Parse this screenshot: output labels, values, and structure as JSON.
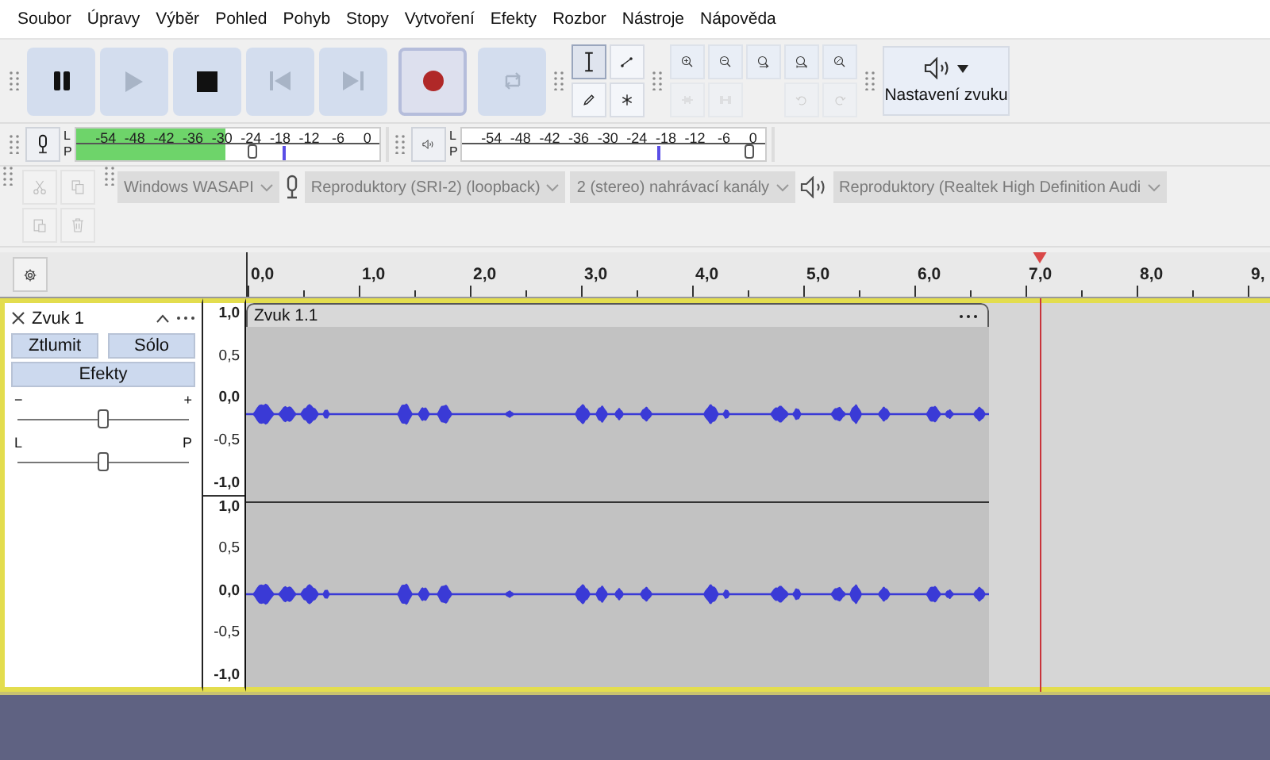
{
  "menu": [
    "Soubor",
    "Úpravy",
    "Výběr",
    "Pohled",
    "Pohyb",
    "Stopy",
    "Vytvoření",
    "Efekty",
    "Rozbor",
    "Nástroje",
    "Nápověda"
  ],
  "transport": [
    {
      "kind": "pause",
      "disabled": false,
      "pressed": false
    },
    {
      "kind": "play",
      "disabled": true,
      "pressed": false
    },
    {
      "kind": "stop",
      "disabled": false,
      "pressed": false
    },
    {
      "kind": "skip-start",
      "disabled": true,
      "pressed": false
    },
    {
      "kind": "skip-end",
      "disabled": true,
      "pressed": false
    },
    {
      "kind": "record",
      "disabled": false,
      "pressed": true
    },
    {
      "kind": "loop",
      "disabled": true,
      "pressed": false
    }
  ],
  "tools": [
    {
      "kind": "select",
      "selected": true
    },
    {
      "kind": "envelope",
      "selected": false
    },
    {
      "kind": "draw",
      "selected": false
    },
    {
      "kind": "multi",
      "selected": false
    }
  ],
  "edit_tools": [
    {
      "kind": "zoom-in",
      "disabled": false
    },
    {
      "kind": "zoom-out",
      "disabled": false
    },
    {
      "kind": "fit-selection",
      "disabled": false
    },
    {
      "kind": "fit-project",
      "disabled": false
    },
    {
      "kind": "zoom-toggle",
      "disabled": false
    },
    {
      "kind": "trim",
      "disabled": true
    },
    {
      "kind": "silence",
      "disabled": true
    },
    {
      "kind": "spacer"
    },
    {
      "kind": "undo",
      "disabled": true
    },
    {
      "kind": "redo",
      "disabled": true
    }
  ],
  "audio_setup": {
    "label": "Nastavení zvuku"
  },
  "meters": [
    {
      "kind": "record",
      "channels": [
        "L",
        "P"
      ],
      "ticks": [
        "-54",
        "-48",
        "-42",
        "-36",
        "-30",
        "-24",
        "-18",
        "-12",
        "-6",
        "0"
      ],
      "fill": {
        "level": 0.49
      },
      "peak": {
        "level": 0.68
      },
      "slider": {
        "level": 0.58
      }
    },
    {
      "kind": "playback",
      "channels": [
        "L",
        "P"
      ],
      "ticks": [
        "-54",
        "-48",
        "-42",
        "-36",
        "-30",
        "-24",
        "-18",
        "-12",
        "-6",
        "0"
      ],
      "peak": {
        "level": 0.645
      },
      "slider": {
        "level": 0.95
      }
    }
  ],
  "clipboard_tools": [
    {
      "kind": "cut",
      "disabled": true
    },
    {
      "kind": "copy",
      "disabled": true
    },
    {
      "kind": "paste",
      "disabled": true
    },
    {
      "kind": "delete",
      "disabled": true
    }
  ],
  "devices": [
    {
      "kind": "combo",
      "label": "Windows WASAPI",
      "disabled": true
    },
    {
      "kind": "mic",
      "disabled": true
    },
    {
      "kind": "combo",
      "label": "Reproduktory (SRI-2) (loopback)",
      "disabled": true
    },
    {
      "kind": "combo",
      "label": "2 (stereo) nahrávací kanály",
      "disabled": true
    },
    {
      "kind": "speaker",
      "disabled": true
    },
    {
      "kind": "combo",
      "label": "Reproduktory (Realtek High Definition Audi",
      "disabled": true
    }
  ],
  "ruler": {
    "labels": [
      "0,0",
      "1,0",
      "2,0",
      "3,0",
      "4,0",
      "5,0",
      "6,0",
      "7,0",
      "8,0",
      "9,"
    ],
    "playhead": {
      "level": 0.775
    }
  },
  "track": {
    "name": "Zvuk 1",
    "buttons": [
      {
        "label": "Ztlumit",
        "selected": false
      },
      {
        "label": "Sólo",
        "selected": false
      }
    ],
    "effects": {
      "label": "Efekty"
    },
    "gain": {
      "min_label": "−",
      "max_label": "+",
      "level": 0.5
    },
    "pan": {
      "min_label": "L",
      "max_label": "P",
      "level": 0.5
    },
    "clip": {
      "name": "Zvuk 1.1"
    },
    "channels": [
      {
        "scale": [
          "1,0",
          "0,5",
          "0,0",
          "-0,5",
          "-1,0"
        ]
      },
      {
        "scale": [
          "1,0",
          "0,5",
          "0,0",
          "-0,5",
          "-1,0"
        ]
      }
    ]
  }
}
